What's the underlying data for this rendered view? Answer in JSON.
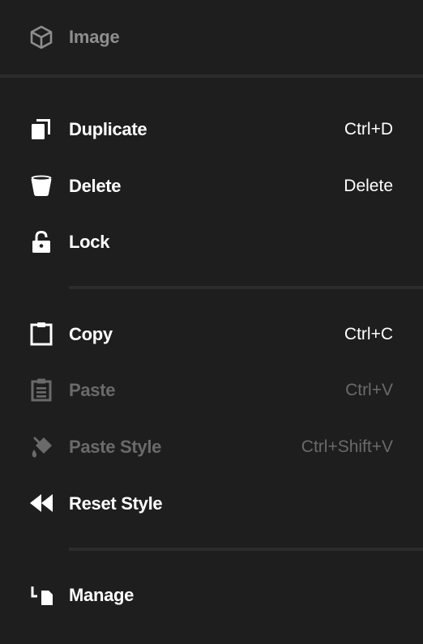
{
  "header": {
    "icon": "cube-icon",
    "title": "Image"
  },
  "items": [
    {
      "label": "Duplicate",
      "shortcut": "Ctrl+D",
      "icon": "duplicate-icon",
      "enabled": true
    },
    {
      "label": "Delete",
      "shortcut": "Delete",
      "icon": "trash-icon",
      "enabled": true
    },
    {
      "label": "Lock",
      "shortcut": "",
      "icon": "lock-icon",
      "enabled": true
    },
    {
      "label": "Copy",
      "shortcut": "Ctrl+C",
      "icon": "clipboard-icon",
      "enabled": true
    },
    {
      "label": "Paste",
      "shortcut": "Ctrl+V",
      "icon": "paste-icon",
      "enabled": false
    },
    {
      "label": "Paste Style",
      "shortcut": "Ctrl+Shift+V",
      "icon": "paint-bucket-icon",
      "enabled": false
    },
    {
      "label": "Reset Style",
      "shortcut": "",
      "icon": "rewind-icon",
      "enabled": true
    },
    {
      "label": "Manage",
      "shortcut": "",
      "icon": "manage-icon",
      "enabled": true
    }
  ],
  "colors": {
    "background": "#1e1e1e",
    "divider": "#2c2c2c",
    "text": "#ffffff",
    "disabled_text": "#6a6a6a",
    "header_text": "#8e8e8e"
  }
}
